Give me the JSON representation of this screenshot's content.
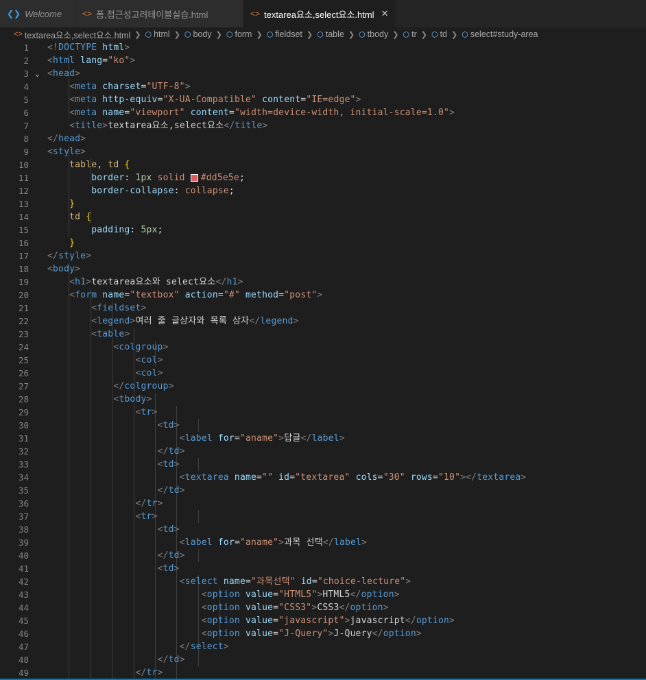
{
  "tabs": [
    {
      "label": "Welcome",
      "icon": "vscode-logo-icon",
      "italic": true
    },
    {
      "label": "폼,접근성고려테이블실습.html",
      "icon": "html-file-icon"
    },
    {
      "label": "textarea요소,select요소.html",
      "icon": "html-file-icon",
      "active": true,
      "close": "✕"
    }
  ],
  "breadcrumbs": [
    "textarea요소,select요소.html",
    "html",
    "body",
    "form",
    "fieldset",
    "table",
    "tbody",
    "tr",
    "td",
    "select#study-area"
  ],
  "colors": {
    "swatch": "#dd5e5e",
    "accent": "#007acc"
  },
  "code_lines": [
    [
      [
        "br",
        "<!"
      ],
      [
        "tag",
        "DOCTYPE"
      ],
      [
        "txt",
        " "
      ],
      [
        "attr",
        "html"
      ],
      [
        "br",
        ">"
      ]
    ],
    [
      [
        "br",
        "<"
      ],
      [
        "tag",
        "html"
      ],
      [
        "txt",
        " "
      ],
      [
        "attr",
        "lang"
      ],
      [
        "txt",
        "="
      ],
      [
        "str",
        "\"ko\""
      ],
      [
        "br",
        ">"
      ]
    ],
    [
      [
        "br",
        "<"
      ],
      [
        "tag",
        "head"
      ],
      [
        "br",
        ">"
      ]
    ],
    [
      [
        "txt",
        "    "
      ],
      [
        "br",
        "<"
      ],
      [
        "tag",
        "meta"
      ],
      [
        "txt",
        " "
      ],
      [
        "attr",
        "charset"
      ],
      [
        "txt",
        "="
      ],
      [
        "str",
        "\"UTF-8\""
      ],
      [
        "br",
        ">"
      ]
    ],
    [
      [
        "txt",
        "    "
      ],
      [
        "br",
        "<"
      ],
      [
        "tag",
        "meta"
      ],
      [
        "txt",
        " "
      ],
      [
        "attr",
        "http-equiv"
      ],
      [
        "txt",
        "="
      ],
      [
        "str",
        "\"X-UA-Compatible\""
      ],
      [
        "txt",
        " "
      ],
      [
        "attr",
        "content"
      ],
      [
        "txt",
        "="
      ],
      [
        "str",
        "\"IE=edge\""
      ],
      [
        "br",
        ">"
      ]
    ],
    [
      [
        "txt",
        "    "
      ],
      [
        "br",
        "<"
      ],
      [
        "tag",
        "meta"
      ],
      [
        "txt",
        " "
      ],
      [
        "attr",
        "name"
      ],
      [
        "txt",
        "="
      ],
      [
        "str",
        "\"viewport\""
      ],
      [
        "txt",
        " "
      ],
      [
        "attr",
        "content"
      ],
      [
        "txt",
        "="
      ],
      [
        "str",
        "\"width=device-width, initial-scale=1.0\""
      ],
      [
        "br",
        ">"
      ]
    ],
    [
      [
        "txt",
        "    "
      ],
      [
        "br",
        "<"
      ],
      [
        "tag",
        "title"
      ],
      [
        "br",
        ">"
      ],
      [
        "txt",
        "textarea요소,select요소"
      ],
      [
        "br",
        "</"
      ],
      [
        "tag",
        "title"
      ],
      [
        "br",
        ">"
      ]
    ],
    [
      [
        "br",
        "</"
      ],
      [
        "tag",
        "head"
      ],
      [
        "br",
        ">"
      ]
    ],
    [
      [
        "br",
        "<"
      ],
      [
        "tag",
        "style"
      ],
      [
        "br",
        ">"
      ]
    ],
    [
      [
        "txt",
        "    "
      ],
      [
        "sel",
        "table"
      ],
      [
        "txt",
        ", "
      ],
      [
        "sel",
        "td"
      ],
      [
        "txt",
        " "
      ],
      [
        "brace",
        "{"
      ]
    ],
    [
      [
        "txt",
        "        "
      ],
      [
        "prop",
        "border"
      ],
      [
        "txt",
        ": "
      ],
      [
        "num",
        "1px"
      ],
      [
        "txt",
        " "
      ],
      [
        "val",
        "solid"
      ],
      [
        "txt",
        " "
      ],
      [
        "swatch",
        ""
      ],
      [
        "val",
        "#dd5e5e"
      ],
      [
        "txt",
        ";"
      ]
    ],
    [
      [
        "txt",
        "        "
      ],
      [
        "prop",
        "border-collapse"
      ],
      [
        "txt",
        ": "
      ],
      [
        "val",
        "collapse"
      ],
      [
        "txt",
        ";"
      ]
    ],
    [
      [
        "txt",
        "    "
      ],
      [
        "brace",
        "}"
      ]
    ],
    [
      [
        "txt",
        "    "
      ],
      [
        "sel",
        "td"
      ],
      [
        "txt",
        " "
      ],
      [
        "brace",
        "{"
      ]
    ],
    [
      [
        "txt",
        "        "
      ],
      [
        "prop",
        "padding"
      ],
      [
        "txt",
        ": "
      ],
      [
        "num",
        "5px"
      ],
      [
        "txt",
        ";"
      ]
    ],
    [
      [
        "txt",
        "    "
      ],
      [
        "brace",
        "}"
      ]
    ],
    [
      [
        "br",
        "</"
      ],
      [
        "tag",
        "style"
      ],
      [
        "br",
        ">"
      ]
    ],
    [
      [
        "br",
        "<"
      ],
      [
        "tag",
        "body"
      ],
      [
        "br",
        ">"
      ]
    ],
    [
      [
        "txt",
        "    "
      ],
      [
        "br",
        "<"
      ],
      [
        "tag",
        "h1"
      ],
      [
        "br",
        ">"
      ],
      [
        "txt",
        "textarea요소와 select요소"
      ],
      [
        "br",
        "</"
      ],
      [
        "tag",
        "h1"
      ],
      [
        "br",
        ">"
      ]
    ],
    [
      [
        "txt",
        "    "
      ],
      [
        "br",
        "<"
      ],
      [
        "tag",
        "form"
      ],
      [
        "txt",
        " "
      ],
      [
        "attr",
        "name"
      ],
      [
        "txt",
        "="
      ],
      [
        "str",
        "\"textbox\""
      ],
      [
        "txt",
        " "
      ],
      [
        "attr",
        "action"
      ],
      [
        "txt",
        "="
      ],
      [
        "str",
        "\"#\""
      ],
      [
        "txt",
        " "
      ],
      [
        "attr",
        "method"
      ],
      [
        "txt",
        "="
      ],
      [
        "str",
        "\"post\""
      ],
      [
        "br",
        ">"
      ]
    ],
    [
      [
        "txt",
        "        "
      ],
      [
        "br",
        "<"
      ],
      [
        "tag",
        "fieldset"
      ],
      [
        "br",
        ">"
      ]
    ],
    [
      [
        "txt",
        "        "
      ],
      [
        "br",
        "<"
      ],
      [
        "tag",
        "legend"
      ],
      [
        "br",
        ">"
      ],
      [
        "txt",
        "여러 줄 글상자와 목록 상자"
      ],
      [
        "br",
        "</"
      ],
      [
        "tag",
        "legend"
      ],
      [
        "br",
        ">"
      ]
    ],
    [
      [
        "txt",
        "        "
      ],
      [
        "br",
        "<"
      ],
      [
        "tag",
        "table"
      ],
      [
        "br",
        ">"
      ]
    ],
    [
      [
        "txt",
        "            "
      ],
      [
        "br",
        "<"
      ],
      [
        "tag",
        "colgroup"
      ],
      [
        "br",
        ">"
      ]
    ],
    [
      [
        "txt",
        "                "
      ],
      [
        "br",
        "<"
      ],
      [
        "tag",
        "col"
      ],
      [
        "br",
        ">"
      ]
    ],
    [
      [
        "txt",
        "                "
      ],
      [
        "br",
        "<"
      ],
      [
        "tag",
        "col"
      ],
      [
        "br",
        ">"
      ]
    ],
    [
      [
        "txt",
        "            "
      ],
      [
        "br",
        "</"
      ],
      [
        "tag",
        "colgroup"
      ],
      [
        "br",
        ">"
      ]
    ],
    [
      [
        "txt",
        "            "
      ],
      [
        "br",
        "<"
      ],
      [
        "tag",
        "tbody"
      ],
      [
        "br",
        ">"
      ]
    ],
    [
      [
        "txt",
        "                "
      ],
      [
        "br",
        "<"
      ],
      [
        "tag",
        "tr"
      ],
      [
        "br",
        ">"
      ]
    ],
    [
      [
        "txt",
        "                    "
      ],
      [
        "br",
        "<"
      ],
      [
        "tag",
        "td"
      ],
      [
        "br",
        ">"
      ]
    ],
    [
      [
        "txt",
        "                        "
      ],
      [
        "br",
        "<"
      ],
      [
        "tag",
        "label"
      ],
      [
        "txt",
        " "
      ],
      [
        "attr",
        "for"
      ],
      [
        "txt",
        "="
      ],
      [
        "str",
        "\"aname\""
      ],
      [
        "br",
        ">"
      ],
      [
        "txt",
        "답글"
      ],
      [
        "br",
        "</"
      ],
      [
        "tag",
        "label"
      ],
      [
        "br",
        ">"
      ]
    ],
    [
      [
        "txt",
        "                    "
      ],
      [
        "br",
        "</"
      ],
      [
        "tag",
        "td"
      ],
      [
        "br",
        ">"
      ]
    ],
    [
      [
        "txt",
        "                    "
      ],
      [
        "br",
        "<"
      ],
      [
        "tag",
        "td"
      ],
      [
        "br",
        ">"
      ]
    ],
    [
      [
        "txt",
        "                        "
      ],
      [
        "br",
        "<"
      ],
      [
        "tag",
        "textarea"
      ],
      [
        "txt",
        " "
      ],
      [
        "attr",
        "name"
      ],
      [
        "txt",
        "="
      ],
      [
        "str",
        "\"\""
      ],
      [
        "txt",
        " "
      ],
      [
        "attr",
        "id"
      ],
      [
        "txt",
        "="
      ],
      [
        "str",
        "\"textarea\""
      ],
      [
        "txt",
        " "
      ],
      [
        "attr",
        "cols"
      ],
      [
        "txt",
        "="
      ],
      [
        "str",
        "\"30\""
      ],
      [
        "txt",
        " "
      ],
      [
        "attr",
        "rows"
      ],
      [
        "txt",
        "="
      ],
      [
        "str",
        "\"10\""
      ],
      [
        "br",
        "></"
      ],
      [
        "tag",
        "textarea"
      ],
      [
        "br",
        ">"
      ]
    ],
    [
      [
        "txt",
        "                    "
      ],
      [
        "br",
        "</"
      ],
      [
        "tag",
        "td"
      ],
      [
        "br",
        ">"
      ]
    ],
    [
      [
        "txt",
        "                "
      ],
      [
        "br",
        "</"
      ],
      [
        "tag",
        "tr"
      ],
      [
        "br",
        ">"
      ]
    ],
    [
      [
        "txt",
        "                "
      ],
      [
        "br",
        "<"
      ],
      [
        "tag",
        "tr"
      ],
      [
        "br",
        ">"
      ]
    ],
    [
      [
        "txt",
        "                    "
      ],
      [
        "br",
        "<"
      ],
      [
        "tag",
        "td"
      ],
      [
        "br",
        ">"
      ]
    ],
    [
      [
        "txt",
        "                        "
      ],
      [
        "br",
        "<"
      ],
      [
        "tag",
        "label"
      ],
      [
        "txt",
        " "
      ],
      [
        "attr",
        "for"
      ],
      [
        "txt",
        "="
      ],
      [
        "str",
        "\"aname\""
      ],
      [
        "br",
        ">"
      ],
      [
        "txt",
        "과목 선택"
      ],
      [
        "br",
        "</"
      ],
      [
        "tag",
        "label"
      ],
      [
        "br",
        ">"
      ]
    ],
    [
      [
        "txt",
        "                    "
      ],
      [
        "br",
        "</"
      ],
      [
        "tag",
        "td"
      ],
      [
        "br",
        ">"
      ]
    ],
    [
      [
        "txt",
        "                    "
      ],
      [
        "br",
        "<"
      ],
      [
        "tag",
        "td"
      ],
      [
        "br",
        ">"
      ]
    ],
    [
      [
        "txt",
        "                        "
      ],
      [
        "br",
        "<"
      ],
      [
        "tag",
        "select"
      ],
      [
        "txt",
        " "
      ],
      [
        "attr",
        "name"
      ],
      [
        "txt",
        "="
      ],
      [
        "str",
        "\"과목선택\""
      ],
      [
        "txt",
        " "
      ],
      [
        "attr",
        "id"
      ],
      [
        "txt",
        "="
      ],
      [
        "str",
        "\"choice-lecture\""
      ],
      [
        "br",
        ">"
      ]
    ],
    [
      [
        "txt",
        "                            "
      ],
      [
        "br",
        "<"
      ],
      [
        "tag",
        "option"
      ],
      [
        "txt",
        " "
      ],
      [
        "attr",
        "value"
      ],
      [
        "txt",
        "="
      ],
      [
        "str",
        "\"HTML5\""
      ],
      [
        "br",
        ">"
      ],
      [
        "txt",
        "HTML5"
      ],
      [
        "br",
        "</"
      ],
      [
        "tag",
        "option"
      ],
      [
        "br",
        ">"
      ]
    ],
    [
      [
        "txt",
        "                            "
      ],
      [
        "br",
        "<"
      ],
      [
        "tag",
        "option"
      ],
      [
        "txt",
        " "
      ],
      [
        "attr",
        "value"
      ],
      [
        "txt",
        "="
      ],
      [
        "str",
        "\"CSS3\""
      ],
      [
        "br",
        ">"
      ],
      [
        "txt",
        "CSS3"
      ],
      [
        "br",
        "</"
      ],
      [
        "tag",
        "option"
      ],
      [
        "br",
        ">"
      ]
    ],
    [
      [
        "txt",
        "                            "
      ],
      [
        "br",
        "<"
      ],
      [
        "tag",
        "option"
      ],
      [
        "txt",
        " "
      ],
      [
        "attr",
        "value"
      ],
      [
        "txt",
        "="
      ],
      [
        "str",
        "\"javascript\""
      ],
      [
        "br",
        ">"
      ],
      [
        "txt",
        "javascript"
      ],
      [
        "br",
        "</"
      ],
      [
        "tag",
        "option"
      ],
      [
        "br",
        ">"
      ]
    ],
    [
      [
        "txt",
        "                            "
      ],
      [
        "br",
        "<"
      ],
      [
        "tag",
        "option"
      ],
      [
        "txt",
        " "
      ],
      [
        "attr",
        "value"
      ],
      [
        "txt",
        "="
      ],
      [
        "str",
        "\"J-Query\""
      ],
      [
        "br",
        ">"
      ],
      [
        "txt",
        "J-Query"
      ],
      [
        "br",
        "</"
      ],
      [
        "tag",
        "option"
      ],
      [
        "br",
        ">"
      ]
    ],
    [
      [
        "txt",
        "                        "
      ],
      [
        "br",
        "</"
      ],
      [
        "tag",
        "select"
      ],
      [
        "br",
        ">"
      ]
    ],
    [
      [
        "txt",
        "                    "
      ],
      [
        "br",
        "</"
      ],
      [
        "tag",
        "td"
      ],
      [
        "br",
        ">"
      ]
    ],
    [
      [
        "txt",
        "                "
      ],
      [
        "br",
        "</"
      ],
      [
        "tag",
        "tr"
      ],
      [
        "br",
        ">"
      ]
    ]
  ]
}
